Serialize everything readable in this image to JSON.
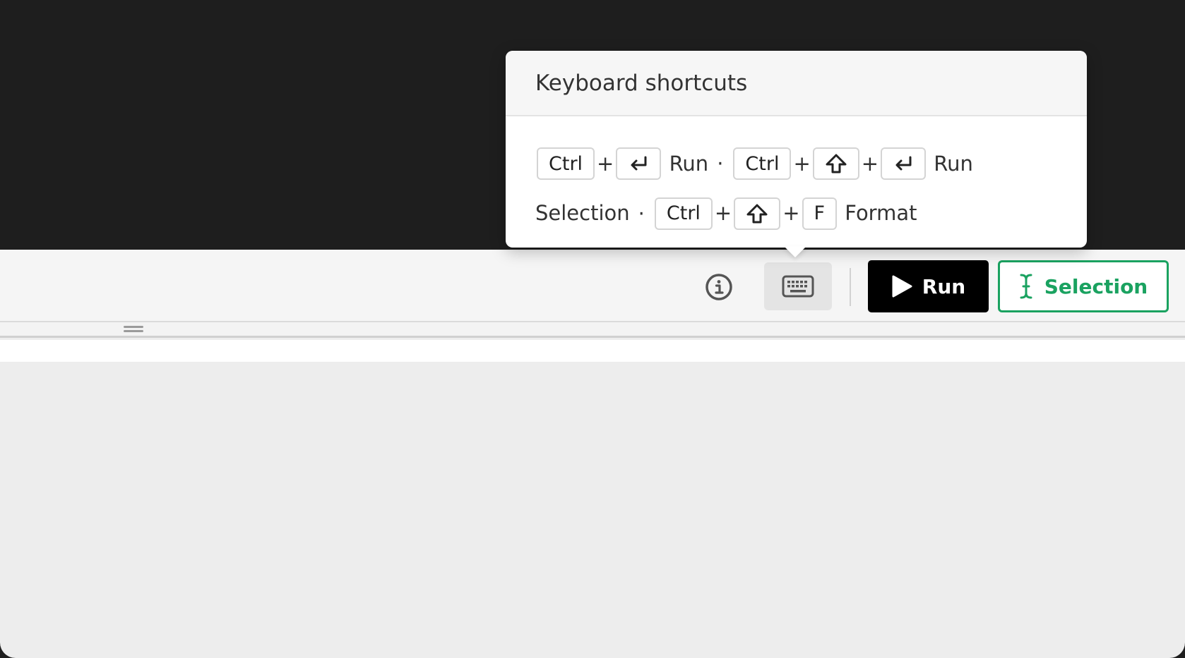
{
  "popover": {
    "title": "Keyboard shortcuts",
    "shortcuts": [
      {
        "keys": [
          "Ctrl",
          "enter-key-icon"
        ],
        "label": "Run"
      },
      {
        "keys": [
          "Ctrl",
          "shift-key-icon",
          "enter-key-icon"
        ],
        "label": "Run Selection"
      },
      {
        "keys": [
          "Ctrl",
          "shift-key-icon",
          "F"
        ],
        "label": "Format"
      }
    ],
    "key_ctrl": "Ctrl",
    "key_f": "F",
    "plus": "+",
    "separator": "·",
    "label_run": "Run",
    "label_run_2": "Run",
    "label_selection": "Selection",
    "label_format": "Format"
  },
  "toolbar": {
    "info_icon": "info-icon",
    "keyboard_icon": "keyboard-icon",
    "run_label": "Run",
    "selection_label": "Selection"
  },
  "colors": {
    "editor_background": "#1e1e1e",
    "run_button": "#000000",
    "selection_accent": "#1aa260",
    "toolbar_background": "#f5f5f5",
    "results_background": "#ededed"
  }
}
